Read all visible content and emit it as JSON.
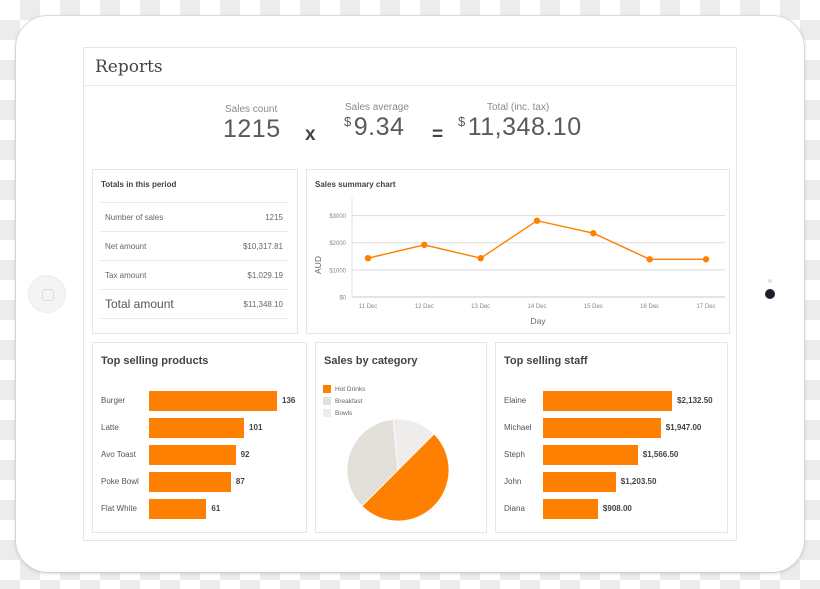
{
  "page": {
    "title": "Reports"
  },
  "summary": {
    "sales_count": {
      "label": "Sales count",
      "value": "1215"
    },
    "multiply_op": "x",
    "sales_average": {
      "label": "Sales average",
      "currency": "$",
      "value": "9.34"
    },
    "equals_op": "=",
    "total": {
      "label": "Total (inc. tax)",
      "currency": "$",
      "value": "11,348.10"
    }
  },
  "totals": {
    "title": "Totals in this period",
    "rows": [
      {
        "label": "Number of sales",
        "value": "1215"
      },
      {
        "label": "Net amount",
        "value": "$10,317.81"
      },
      {
        "label": "Tax amount",
        "value": "$1,029.19"
      },
      {
        "label": "Total amount",
        "value": "$11,348.10"
      }
    ]
  },
  "colors": {
    "accent": "#ff8000",
    "breakfast": "#e3dfd9",
    "bowls": "#efedeb",
    "gridline": "#dddddd"
  },
  "chart_data": [
    {
      "type": "line",
      "title": "Sales summary chart",
      "xlabel": "Day",
      "ylabel": "AUD",
      "categories": [
        "11 Dec",
        "12 Dec",
        "13 Dec",
        "14 Dec",
        "15 Dec",
        "16 Dec",
        "17 Dec"
      ],
      "series": [
        {
          "name": "Sales",
          "values": [
            1430,
            1920,
            1430,
            2810,
            2350,
            1390,
            1390
          ]
        }
      ],
      "yticks": [
        0,
        1000,
        2000,
        3000
      ],
      "ytick_labels": [
        "$0",
        "$1000",
        "$2000",
        "$3000"
      ],
      "ylim": [
        0,
        3500
      ],
      "grid": true
    },
    {
      "type": "bar",
      "orientation": "horizontal",
      "title": "Top selling products",
      "categories": [
        "Burger",
        "Latte",
        "Avo Toast",
        "Poke Bowl",
        "Flat White"
      ],
      "values": [
        136,
        101,
        92,
        87,
        61
      ],
      "value_labels": [
        "136",
        "101",
        "92",
        "87",
        "61"
      ]
    },
    {
      "type": "pie",
      "title": "Sales by category",
      "categories": [
        "Hot Drinks",
        "Breakfast",
        "Bowls"
      ],
      "values": [
        50,
        36,
        14
      ],
      "legend": "top-left"
    },
    {
      "type": "bar",
      "orientation": "horizontal",
      "title": "Top selling staff",
      "categories": [
        "Elaine",
        "Michael",
        "Steph",
        "John",
        "Diana"
      ],
      "values": [
        2132.5,
        1947.0,
        1566.5,
        1203.5,
        908.0
      ],
      "value_labels": [
        "$2,132.50",
        "$1,947.00",
        "$1,566.50",
        "$1,203.50",
        "$908.00"
      ]
    }
  ]
}
